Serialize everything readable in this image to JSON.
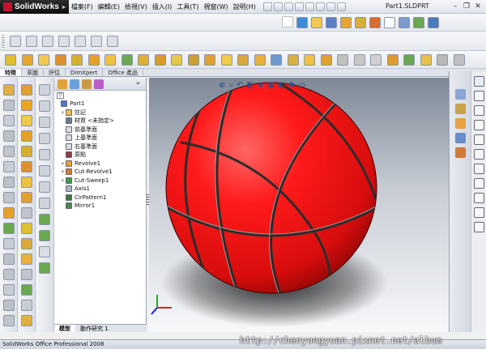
{
  "app": {
    "name": "SolidWorks",
    "doc_title": "Part1.SLDPRT"
  },
  "menu": [
    "檔案(F)",
    "編輯(E)",
    "檢視(V)",
    "插入(I)",
    "工具(T)",
    "視窗(W)",
    "說明(H)"
  ],
  "tabs": [
    "特徵",
    "草圖",
    "評估",
    "DimXpert",
    "Office 產品"
  ],
  "feature_tree": [
    {
      "label": "Part1",
      "icon": "part-icon",
      "expander": ""
    },
    {
      "label": "註記",
      "icon": "annotation-icon",
      "expander": "+"
    },
    {
      "label": "材質 <未指定>",
      "icon": "material-icon",
      "expander": ""
    },
    {
      "label": "前基準面",
      "icon": "plane-icon",
      "expander": ""
    },
    {
      "label": "上基準面",
      "icon": "plane-icon",
      "expander": ""
    },
    {
      "label": "右基準面",
      "icon": "plane-icon",
      "expander": ""
    },
    {
      "label": "原點",
      "icon": "origin-icon",
      "expander": ""
    },
    {
      "label": "Revolve1",
      "icon": "revolve-icon",
      "expander": "+"
    },
    {
      "label": "Cut-Revolve1",
      "icon": "cut-revolve-icon",
      "expander": "+"
    },
    {
      "label": "Cut-Sweep1",
      "icon": "cut-sweep-icon",
      "expander": "+"
    },
    {
      "label": "Axis1",
      "icon": "axis-icon",
      "expander": ""
    },
    {
      "label": "CirPattern1",
      "icon": "circular-pattern-icon",
      "expander": ""
    },
    {
      "label": "Mirror1",
      "icon": "mirror-icon",
      "expander": ""
    }
  ],
  "fm_bottom_tabs": [
    "模型",
    "動作研究 1"
  ],
  "status_text": "SolidWorks Office Professional 2008",
  "watermark": "http://chenyongyuan.pixnet.net/album",
  "colors": {
    "ball": "#ff1a1a",
    "seam": "#3a3a3a",
    "accent": "#3a6fc4"
  }
}
